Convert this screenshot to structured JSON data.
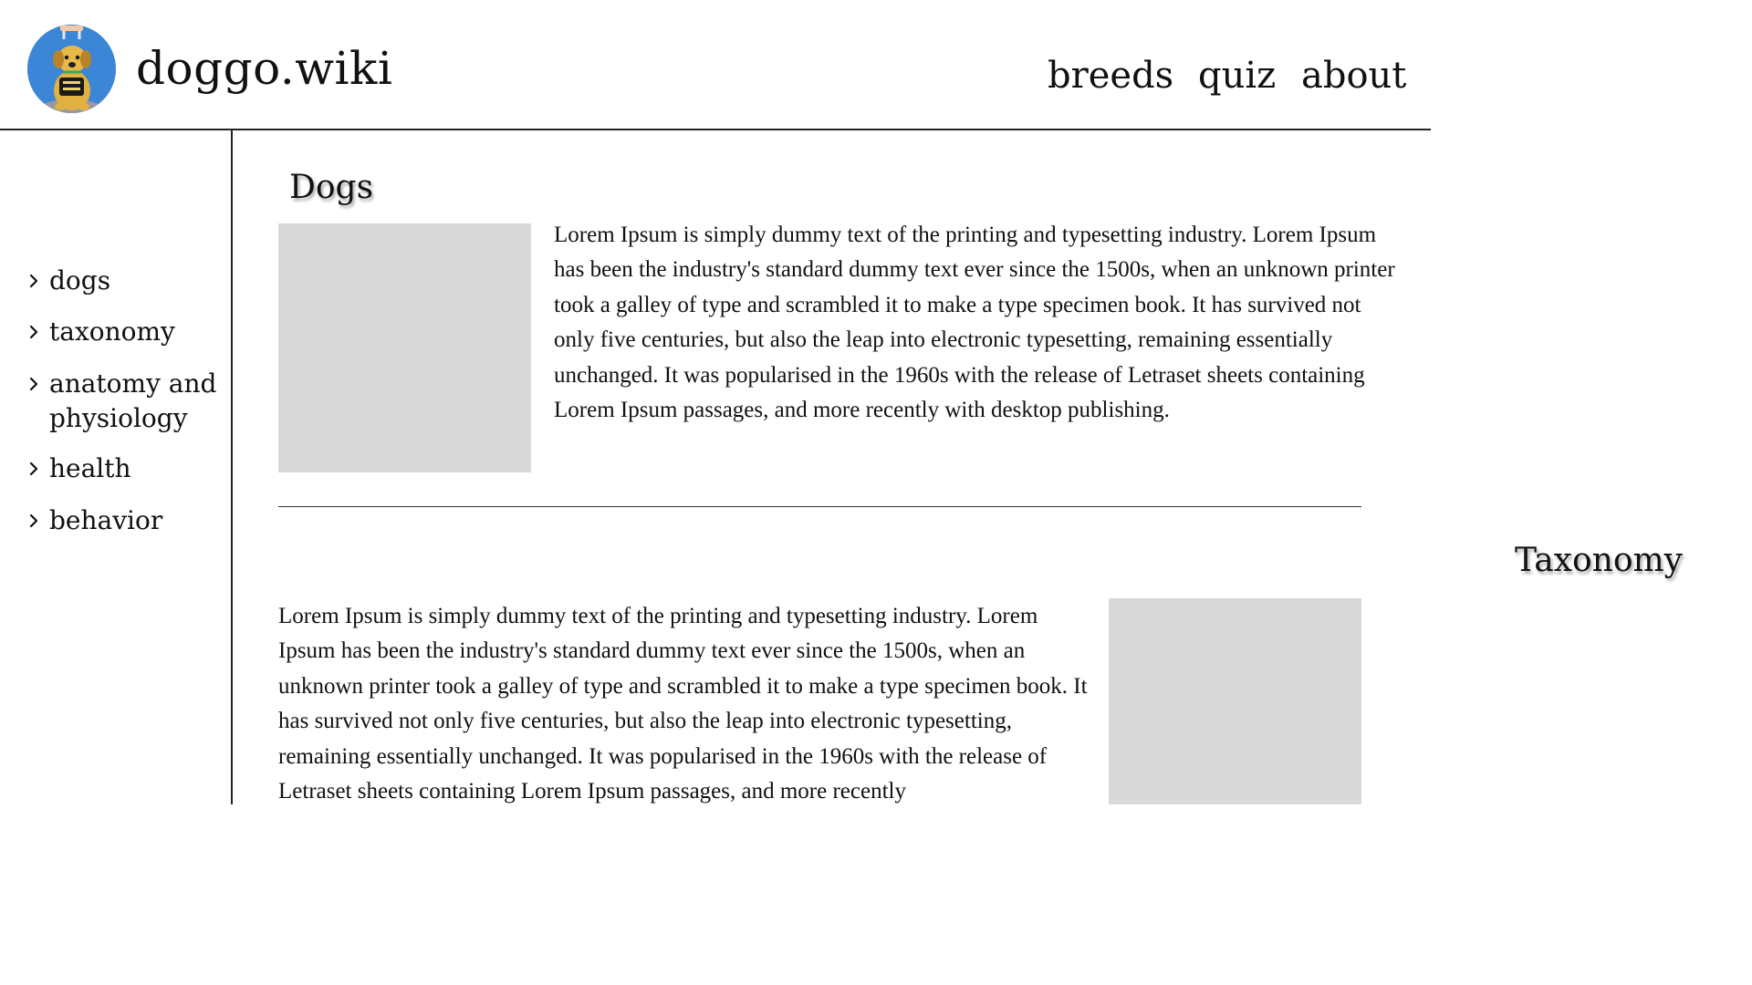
{
  "header": {
    "site_title": "doggo.wiki",
    "logo_icon": "dog-logo-icon",
    "nav": [
      {
        "label": "breeds"
      },
      {
        "label": "quiz"
      },
      {
        "label": "about"
      }
    ]
  },
  "sidebar": {
    "items": [
      {
        "label": "dogs",
        "icon": "chevron-right-icon"
      },
      {
        "label": "taxonomy",
        "icon": "chevron-right-icon"
      },
      {
        "label": "anatomy and physiology",
        "icon": "chevron-right-icon"
      },
      {
        "label": "health",
        "icon": "chevron-right-icon"
      },
      {
        "label": "behavior",
        "icon": "chevron-right-icon"
      }
    ]
  },
  "main": {
    "sections": [
      {
        "title": "Dogs",
        "text": "Lorem Ipsum is simply dummy text of the printing and typesetting industry. Lorem Ipsum has been the industry's standard dummy text ever since the 1500s, when an unknown printer took a galley of type and scrambled it to make a type specimen book. It has survived not only five centuries, but also the leap into electronic typesetting, remaining essentially unchanged. It was popularised in the 1960s with the release of Letraset sheets containing Lorem Ipsum passages, and more recently with desktop publishing."
      },
      {
        "title": "Taxonomy",
        "text": "Lorem Ipsum is simply dummy text of the printing and typesetting industry. Lorem Ipsum has been the industry's standard dummy text ever since the 1500s, when an unknown printer took a galley of type and scrambled it to make a type specimen book. It has survived not only five centuries, but also the leap into electronic typesetting, remaining essentially unchanged. It was popularised in the 1960s with the release of Letraset sheets containing Lorem Ipsum passages, and more recently"
      }
    ]
  },
  "colors": {
    "logo_background": "#3b86d6",
    "placeholder": "#d9d9d9",
    "border": "#222222"
  }
}
